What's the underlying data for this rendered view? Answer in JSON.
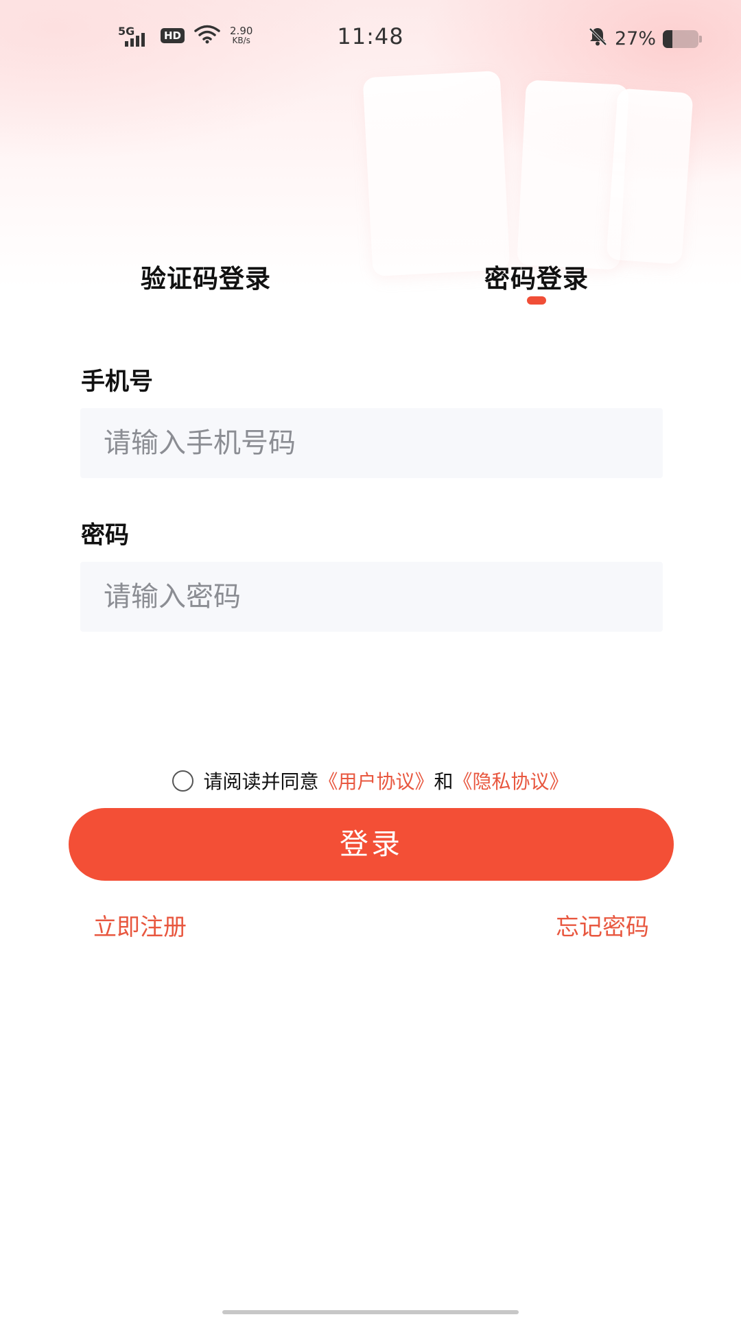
{
  "status_bar": {
    "network": "5G",
    "hd": "HD",
    "speed_value": "2.90",
    "speed_unit": "KB/s",
    "time": "11:48",
    "battery_percent": "27%",
    "battery_level": 0.27,
    "icons": [
      "signal-icon",
      "wifi-icon",
      "mute-bell-icon",
      "battery-icon"
    ]
  },
  "tabs": [
    {
      "label": "验证码登录",
      "active": false
    },
    {
      "label": "密码登录",
      "active": true
    }
  ],
  "phone": {
    "label": "手机号",
    "placeholder": "请输入手机号码",
    "value": ""
  },
  "password": {
    "label": "密码",
    "placeholder": "请输入密码",
    "value": ""
  },
  "agreement": {
    "checked": false,
    "prefix": "请阅读并同意",
    "user_agreement": "《用户协议》",
    "and": "和",
    "privacy_policy": "《隐私协议》"
  },
  "login_button": "登录",
  "register_link": "立即注册",
  "forgot_link": "忘记密码",
  "colors": {
    "accent": "#f34f36",
    "link": "#e8573f",
    "input_bg": "#f7f8fb"
  }
}
